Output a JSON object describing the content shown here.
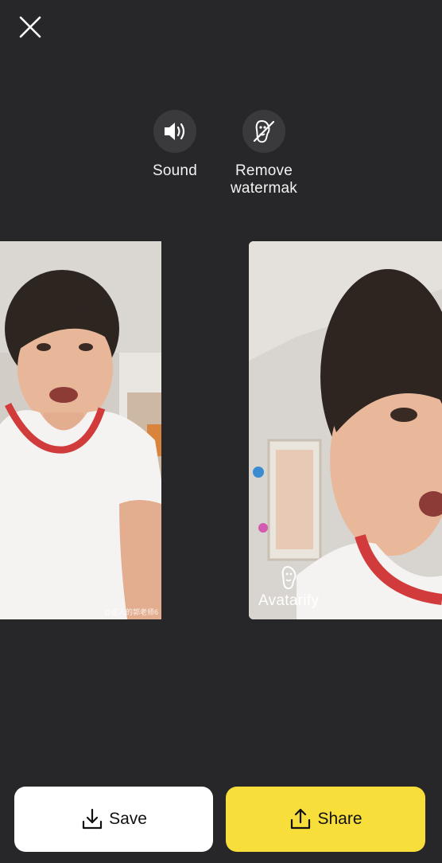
{
  "header": {
    "close_icon": "close-icon"
  },
  "options": {
    "sound": {
      "label": "Sound",
      "icon": "speaker-icon"
    },
    "watermark": {
      "label": "Remove\nwatermak",
      "icon": "avatar-no-watermark-icon"
    }
  },
  "previews": {
    "original": {
      "credit": "@这人的郭老师6"
    },
    "avatarified": {
      "watermark_text": "Avatarify",
      "watermark_icon": "avatarify-logo-icon"
    }
  },
  "actions": {
    "save_label": "Save",
    "share_label": "Share"
  },
  "colors": {
    "background": "#272729",
    "share_button": "#f7de3b",
    "save_button": "#ffffff"
  }
}
